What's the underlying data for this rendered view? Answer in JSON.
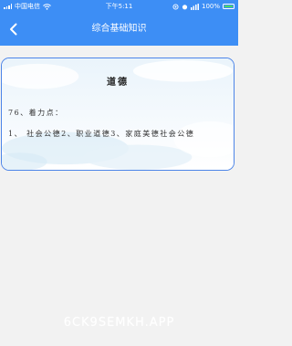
{
  "status_bar": {
    "carrier": "中国电信",
    "time": "下午5:11",
    "battery": "100%"
  },
  "navbar": {
    "title": "综合基础知识",
    "back_icon": "chevron-left-icon"
  },
  "card": {
    "title": "道德",
    "line1": "76、着力点：",
    "line2": "1、 社会公德2、职业道德3、家庭美德社会公德"
  },
  "watermark": "6CK9SEMKH.APP",
  "colors": {
    "primary": "#3d8ef5",
    "card_border": "#4d85e8",
    "background": "#f2f2f2"
  }
}
